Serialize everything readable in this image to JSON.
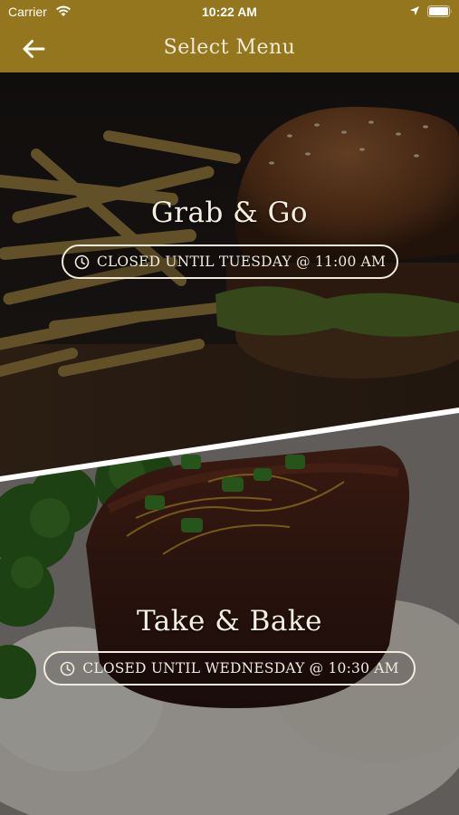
{
  "status_bar": {
    "carrier": "Carrier",
    "time": "10:22 AM",
    "icons": [
      "wifi-icon",
      "location-arrow-icon",
      "battery-icon"
    ]
  },
  "header": {
    "title": "Select Menu",
    "back_icon": "arrow-left-icon",
    "background_color": "#94761f"
  },
  "menus": [
    {
      "title": "Grab & Go",
      "status": "CLOSED UNTIL TUESDAY @ 11:00 AM",
      "status_icon": "clock-icon",
      "image": "burger-and-fries-photo"
    },
    {
      "title": "Take & Bake",
      "status": "CLOSED UNTIL WEDNESDAY @ 10:30 AM",
      "status_icon": "clock-icon",
      "image": "short-rib-rice-broccoli-photo"
    }
  ]
}
